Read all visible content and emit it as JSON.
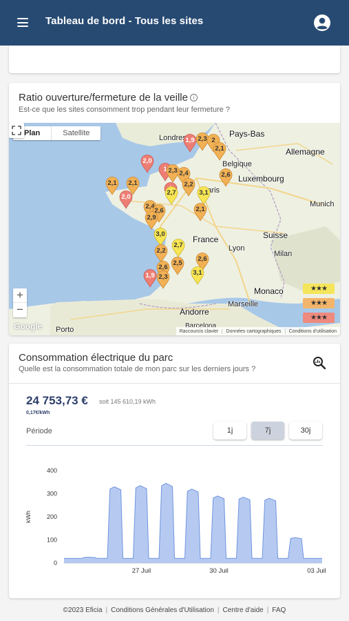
{
  "header": {
    "title": "Tableau de bord - Tous les sites",
    "menu_icon": "menu-icon",
    "account_icon": "account-circle-icon"
  },
  "ratio_card": {
    "title": "Ratio ouverture/fermeture de la veille",
    "info_icon": "info-icon",
    "subtitle": "Est-ce que les sites consomment trop pendant leur fermeture ?",
    "map": {
      "toggle": {
        "plan": "Plan",
        "satellite": "Satellite"
      },
      "places": [
        "Londres",
        "Pays-Bas",
        "Allemagne",
        "Belgique",
        "Luxembourg",
        "Paris",
        "Munich",
        "France",
        "Suisse",
        "Lyon",
        "Milan",
        "Monaco",
        "Marseille",
        "Andorre",
        "Porto",
        "Barcelona"
      ],
      "markers": [
        {
          "value": "1,9",
          "rating": "red"
        },
        {
          "value": "2,3",
          "rating": "orange"
        },
        {
          "value": "2",
          "rating": "orange"
        },
        {
          "value": "2,1",
          "rating": "orange"
        },
        {
          "value": "2,0",
          "rating": "red"
        },
        {
          "value": "1",
          "rating": "red"
        },
        {
          "value": "2,3",
          "rating": "orange"
        },
        {
          "value": "2,4",
          "rating": "orange"
        },
        {
          "value": "2,6",
          "rating": "orange"
        },
        {
          "value": "2,1",
          "rating": "orange"
        },
        {
          "value": "2,1",
          "rating": "orange"
        },
        {
          "value": "2,0",
          "rating": "red"
        },
        {
          "value": "1",
          "rating": "red"
        },
        {
          "value": "2,7",
          "rating": "yellow"
        },
        {
          "value": "2,2",
          "rating": "orange"
        },
        {
          "value": "3,1",
          "rating": "yellow"
        },
        {
          "value": "2,4",
          "rating": "orange"
        },
        {
          "value": "2,6",
          "rating": "orange"
        },
        {
          "value": "2,9",
          "rating": "orange"
        },
        {
          "value": "2,1",
          "rating": "orange"
        },
        {
          "value": "3,0",
          "rating": "yellow"
        },
        {
          "value": "2,7",
          "rating": "yellow"
        },
        {
          "value": "2,2",
          "rating": "orange"
        },
        {
          "value": "2,6",
          "rating": "orange"
        },
        {
          "value": "2,5",
          "rating": "orange"
        },
        {
          "value": "2,6",
          "rating": "orange"
        },
        {
          "value": "1,9",
          "rating": "red"
        },
        {
          "value": "2,3",
          "rating": "orange"
        },
        {
          "value": "3,1",
          "rating": "yellow"
        }
      ],
      "legend": [
        {
          "stars": "★★★",
          "color": "#f5e55a"
        },
        {
          "stars": "★★★",
          "color": "#f2b56b"
        },
        {
          "stars": "★★★",
          "color": "#ee8a7e"
        }
      ],
      "zoom_in": "+",
      "zoom_out": "−",
      "google": "Google",
      "attribution": {
        "keyboard": "Raccourcis clavier",
        "data": "Données cartographiques",
        "terms": "Conditions d'utilisation"
      }
    }
  },
  "conso_card": {
    "title": "Consommation électrique du parc",
    "subtitle": "Quelle est la consommation totale de mon parc sur les derniers jours ?",
    "action_icon": "zoom-chart-icon",
    "total": "24 753,73 €",
    "total_kwh": "soit 145 610,19 kWh",
    "unit_price": "0,17€/kWh",
    "period_label": "Période",
    "periods": [
      "1j",
      "7j",
      "30j"
    ],
    "active_period": "7j"
  },
  "chart_data": {
    "type": "area",
    "ylabel": "kWh",
    "ylim": [
      0,
      400
    ],
    "yticks": [
      0,
      100,
      200,
      300,
      400
    ],
    "xticks": [
      "27 Juil",
      "30 Juil",
      "03 Juil"
    ],
    "color": "#9db8ec",
    "x": [
      "24 Juil",
      "25 Juil",
      "26 Juil",
      "27 Juil",
      "28 Juil",
      "29 Juil",
      "30 Juil",
      "31 Juil",
      "01 Août",
      "02 Août",
      "03 Août"
    ],
    "values": [
      20,
      25,
      330,
      335,
      345,
      320,
      290,
      285,
      280,
      110,
      20
    ]
  },
  "footer": {
    "copyright": "©2023 Eficia",
    "links": [
      "Conditions Générales d'Utilisation",
      "Centre d'aide",
      "FAQ"
    ]
  }
}
